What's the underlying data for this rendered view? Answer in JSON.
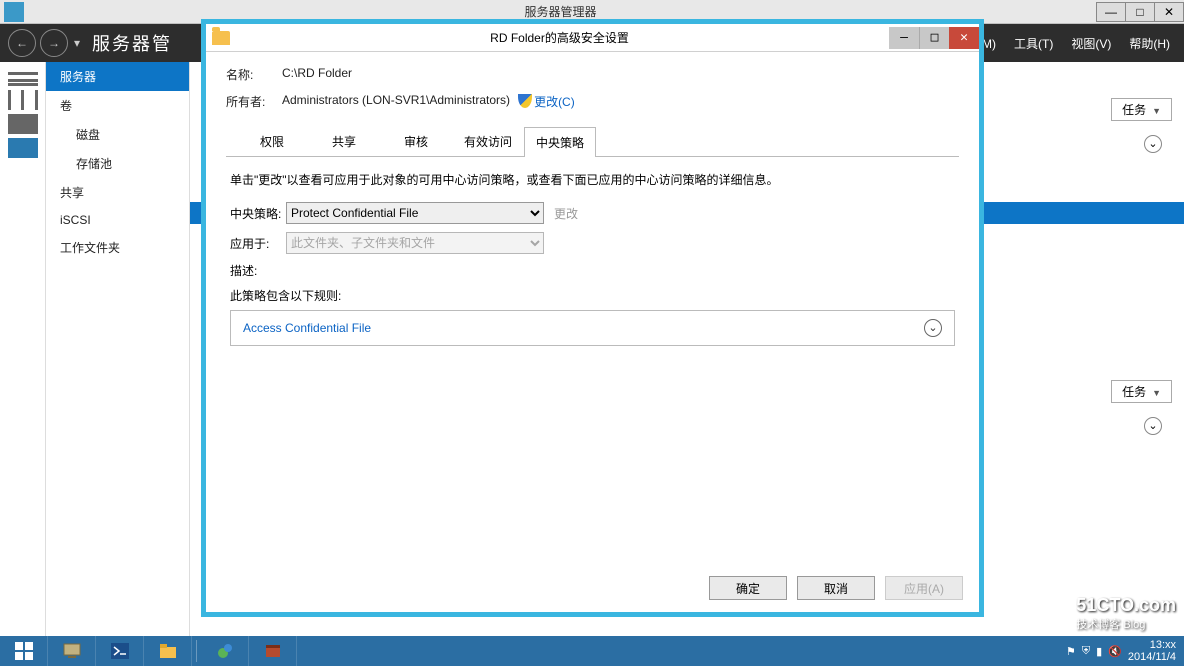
{
  "outer": {
    "title": "服务器管理器",
    "nav_breadcrumb": "服务器管",
    "menu": {
      "manage": "理(M)",
      "tools": "工具(T)",
      "view": "视图(V)",
      "help": "帮助(H)"
    }
  },
  "sidebar": {
    "items": [
      {
        "label": "服务器",
        "active": true
      },
      {
        "label": "卷"
      },
      {
        "label": "磁盘",
        "indent": true
      },
      {
        "label": "存储池",
        "indent": true
      },
      {
        "label": "共享"
      },
      {
        "label": "iSCSI"
      },
      {
        "label": "工作文件夹"
      }
    ]
  },
  "content": {
    "tasks_label": "任务"
  },
  "dialog": {
    "title": "RD Folder的高级安全设置",
    "name_label": "名称:",
    "name_value": "C:\\RD Folder",
    "owner_label": "所有者:",
    "owner_value": "Administrators (LON-SVR1\\Administrators)",
    "change_link": "更改(C)",
    "tabs": [
      "权限",
      "共享",
      "审核",
      "有效访问",
      "中央策略"
    ],
    "active_tab_index": 4,
    "instruction": "单击\"更改\"以查看可应用于此对象的可用中心访问策略，或查看下面已应用的中心访问策略的详细信息。",
    "central_policy_label": "中央策略:",
    "central_policy_value": "Protect Confidential File",
    "central_policy_change": "更改",
    "applies_label": "应用于:",
    "applies_value": "此文件夹、子文件夹和文件",
    "description_label": "描述:",
    "rules_header": "此策略包含以下规则:",
    "rules": [
      {
        "name": "Access Confidential File"
      }
    ],
    "buttons": {
      "ok": "确定",
      "cancel": "取消",
      "apply": "应用(A)"
    }
  },
  "taskbar": {
    "time": "13:xx",
    "date": "2014/11/4"
  },
  "watermark": {
    "site": "51CTO.com",
    "sub": "技术博客  Blog"
  }
}
